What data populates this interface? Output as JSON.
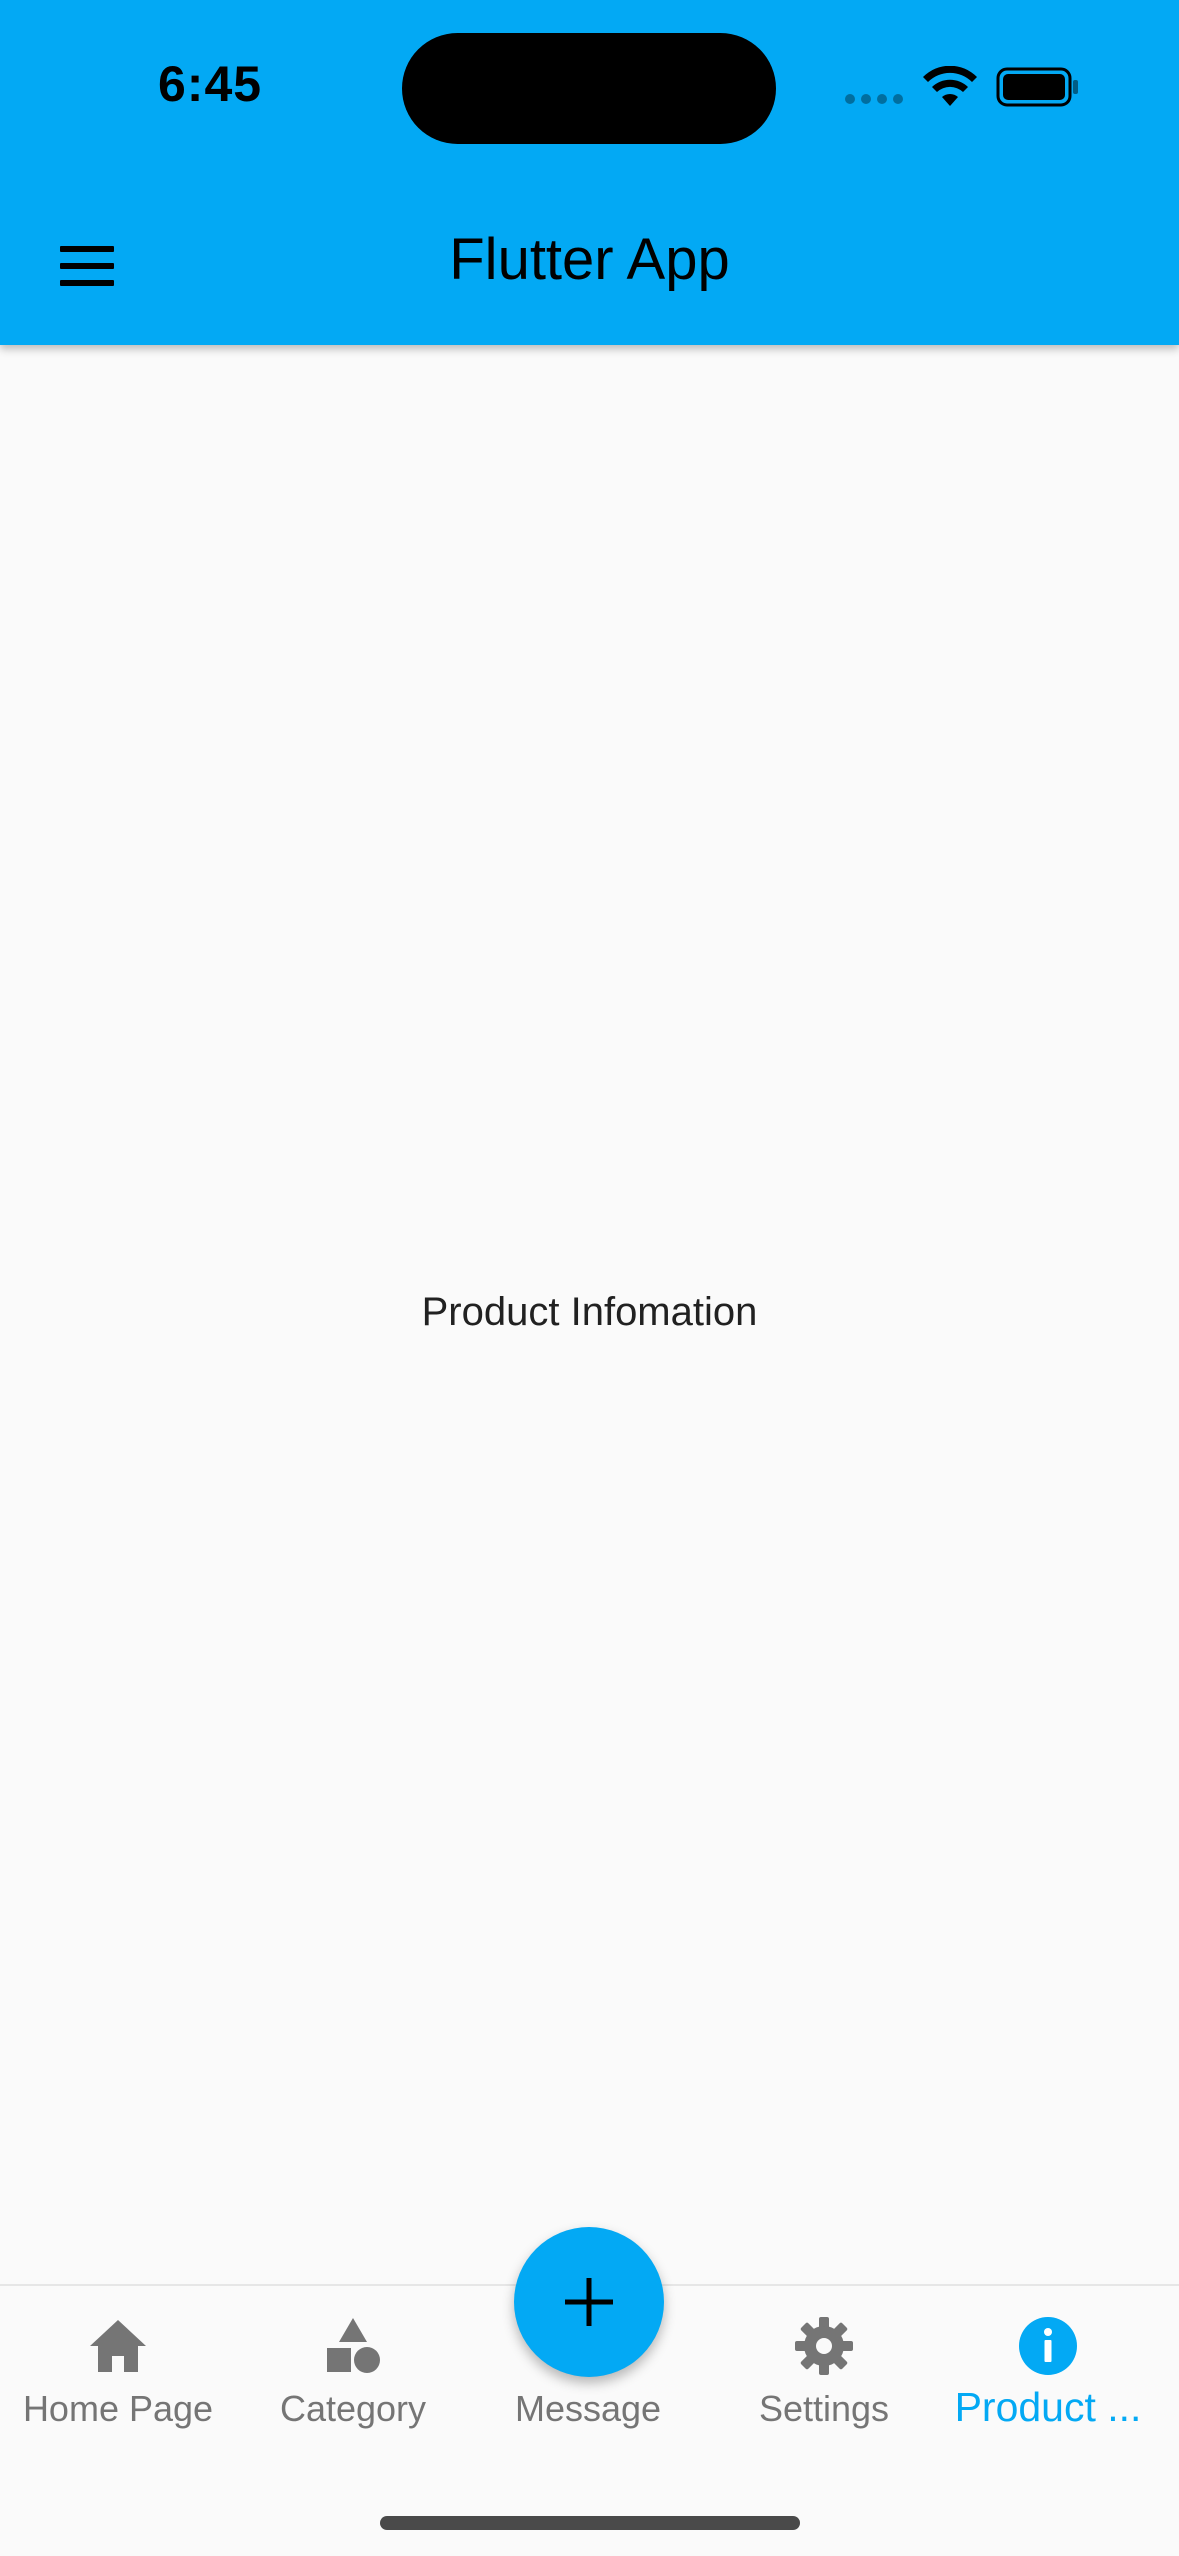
{
  "status_bar": {
    "time": "6:45"
  },
  "app_bar": {
    "title": "Flutter App",
    "menu_icon": "hamburger-menu-icon",
    "background_color": "#03a9f4"
  },
  "body": {
    "text": "Product Infomation"
  },
  "fab": {
    "icon": "plus-icon",
    "color": "#03a9f4"
  },
  "bottom_nav": {
    "items": [
      {
        "label": "Home Page",
        "icon": "home-icon",
        "active": false
      },
      {
        "label": "Category",
        "icon": "category-shapes-icon",
        "active": false
      },
      {
        "label": "Message",
        "icon": "",
        "active": false
      },
      {
        "label": "Settings",
        "icon": "gear-icon",
        "active": false
      },
      {
        "label": "Product ...",
        "icon": "info-icon",
        "active": true
      }
    ],
    "active_color": "#03a9f4",
    "inactive_color": "#757575"
  }
}
